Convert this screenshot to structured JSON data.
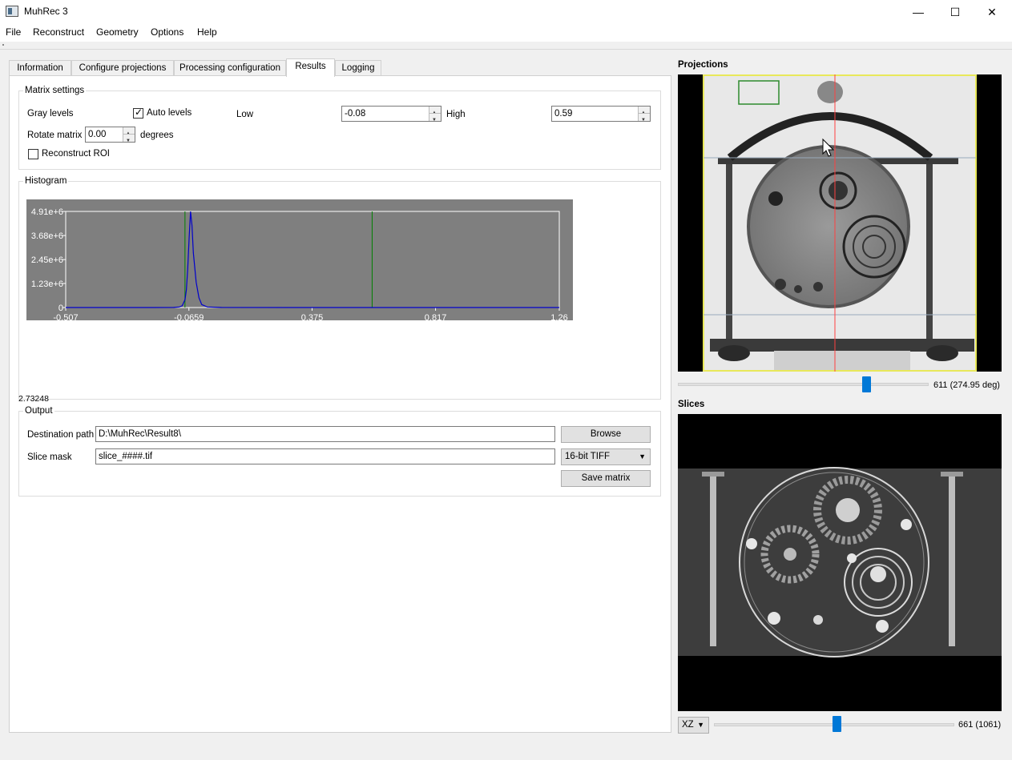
{
  "window": {
    "title": "MuhRec 3",
    "minimize_glyph": "—",
    "maximize_glyph": "☐",
    "close_glyph": "✕"
  },
  "menu": [
    "File",
    "Reconstruct",
    "Geometry",
    "Options",
    "Help"
  ],
  "tabs": {
    "information": "Information",
    "configure_projections": "Configure projections",
    "processing_configuration": "Processing configuration",
    "results": "Results",
    "logging": "Logging",
    "active": "Results"
  },
  "matrix_settings": {
    "title": "Matrix settings",
    "gray_levels_label": "Gray levels",
    "auto_levels_label": "Auto levels",
    "auto_levels_checked": true,
    "low_label": "Low",
    "low_value": "-0.08",
    "high_label": "High",
    "high_value": "0.59",
    "rotate_label": "Rotate matrix",
    "rotate_value": "0.00",
    "degrees_label": "degrees",
    "reconstruct_roi_label": "Reconstruct ROI",
    "reconstruct_roi_checked": false
  },
  "histogram": {
    "title": "Histogram",
    "bottom_value": "2.73248"
  },
  "chart_data": {
    "type": "line",
    "title": "",
    "xlabel": "",
    "ylabel": "",
    "x_ticks": [
      "-0.507",
      "-0.0659",
      "0.375",
      "0.817",
      "1.26"
    ],
    "y_ticks": [
      "0",
      "1.23e+6",
      "2.45e+6",
      "3.68e+6",
      "4.91e+6"
    ],
    "xlim": [
      -0.507,
      1.26
    ],
    "ylim": [
      0,
      4910000
    ],
    "series": [
      {
        "color": "#0000cc",
        "x": [
          -0.507,
          -0.2,
          -0.12,
          -0.1,
          -0.09,
          -0.08,
          -0.075,
          -0.07,
          -0.065,
          -0.06,
          -0.055,
          -0.05,
          -0.04,
          -0.03,
          -0.02,
          0.0,
          0.05,
          0.3,
          0.8,
          1.26
        ],
        "y": [
          0,
          0,
          5000,
          30000,
          90000,
          400000,
          900000,
          2000000,
          3600000,
          4910000,
          4200000,
          2800000,
          1300000,
          500000,
          150000,
          30000,
          5000,
          0,
          0,
          0
        ]
      }
    ],
    "markers": [
      {
        "x": -0.08,
        "color": "#008000"
      },
      {
        "x": 0.59,
        "color": "#008000"
      }
    ],
    "grid": false,
    "background": "#7f7f7f"
  },
  "output": {
    "title": "Output",
    "destination_label": "Destination path",
    "destination_value": "D:\\MuhRec\\Result8\\",
    "browse_label": "Browse",
    "slice_mask_label": "Slice mask",
    "slice_mask_value": "slice_####.tif",
    "format_value": "16-bit TIFF",
    "save_matrix_label": "Save matrix"
  },
  "projections": {
    "title": "Projections",
    "slider_text": "611 (274.95 deg)",
    "slider_fraction": 0.75
  },
  "slices": {
    "title": "Slices",
    "plane_value": "XZ",
    "slider_text": "661 (1061)",
    "slider_fraction": 0.51
  },
  "colors": {
    "accent": "#0078d7",
    "marker_green": "#008000",
    "curve_blue": "#0000cc",
    "roi_yellow": "#e8e85a",
    "profile_red": "#ff4040"
  }
}
